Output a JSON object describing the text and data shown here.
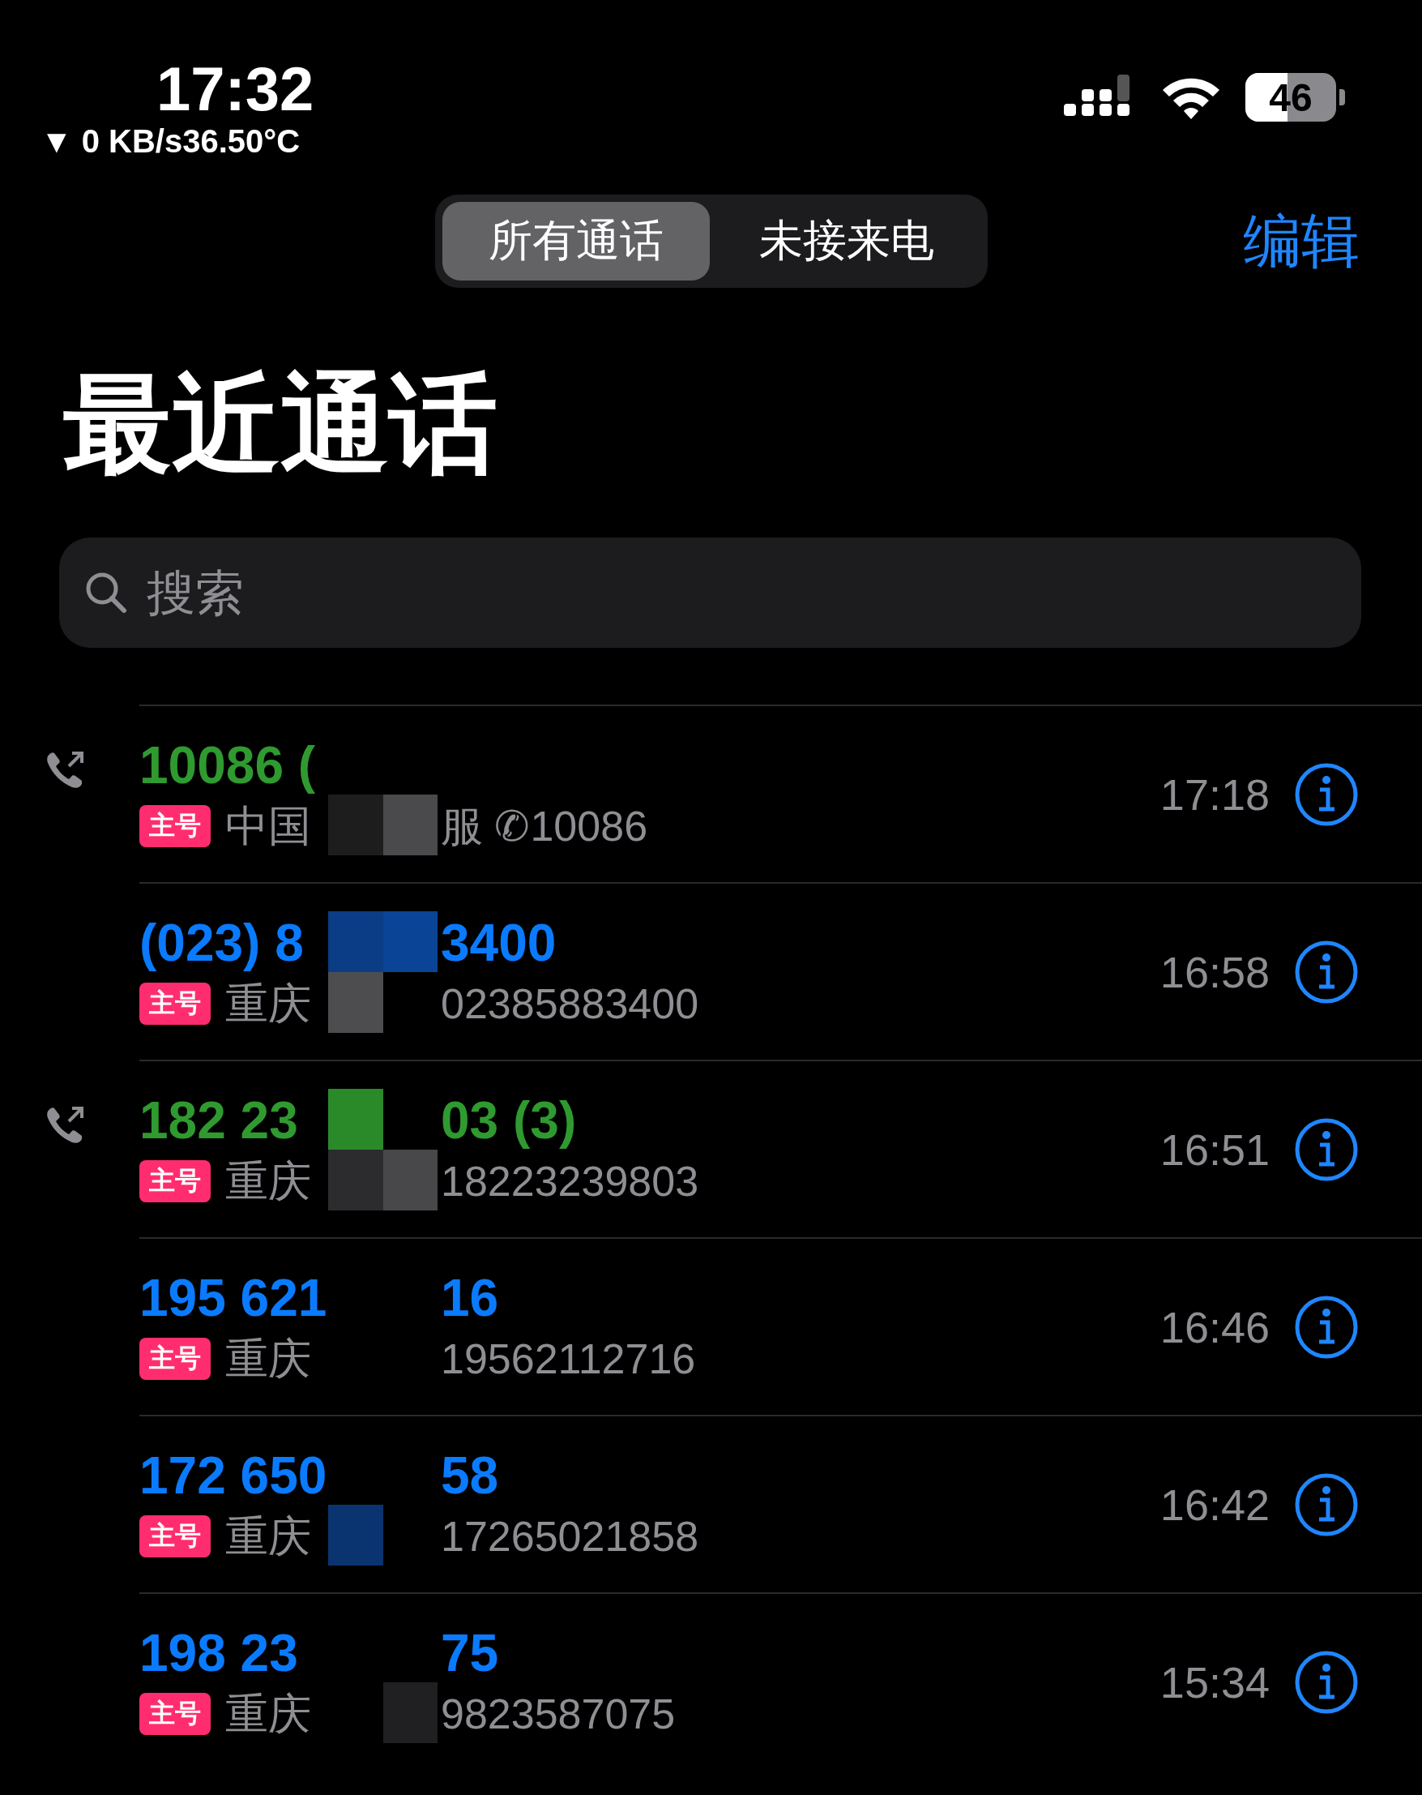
{
  "status_bar": {
    "time": "17:32",
    "network": "▼ 0 KB/s36.50°C",
    "battery": "46"
  },
  "segments": [
    {
      "label": "所有通话",
      "selected": true
    },
    {
      "label": "未接来电",
      "selected": false
    }
  ],
  "edit_button": "编辑",
  "title": "最近通话",
  "search": {
    "placeholder": "搜索"
  },
  "calls": [
    {
      "outgoing": true,
      "kind": "answered",
      "name_start": "10086 (",
      "badge": "主号",
      "place_start": "中国",
      "place_end": "服 ✆10086",
      "time": "17:18"
    },
    {
      "outgoing": false,
      "kind": "missed",
      "name_start": "(023) 8",
      "name_end": "3400",
      "badge": "主号",
      "place_start": "重庆",
      "place_end": "02385883400",
      "time": "16:58"
    },
    {
      "outgoing": true,
      "kind": "answered",
      "name_start": "182 23",
      "name_end": "03 (3)",
      "badge": "主号",
      "place_start": "重庆",
      "place_end": "18223239803",
      "time": "16:51"
    },
    {
      "outgoing": false,
      "kind": "missed",
      "name_start": "195 621",
      "name_end": "16",
      "badge": "主号",
      "place_start": "重庆",
      "place_end": "19562112716",
      "time": "16:46"
    },
    {
      "outgoing": false,
      "kind": "missed",
      "name_start": "172 650",
      "name_end": "58",
      "badge": "主号",
      "place_start": "重庆",
      "place_end": "17265021858",
      "time": "16:42"
    },
    {
      "outgoing": false,
      "kind": "missed",
      "name_start": "198 23",
      "name_end": "75",
      "badge": "主号",
      "place_start": "重庆",
      "place_end": "9823587075",
      "time": "15:34"
    }
  ]
}
